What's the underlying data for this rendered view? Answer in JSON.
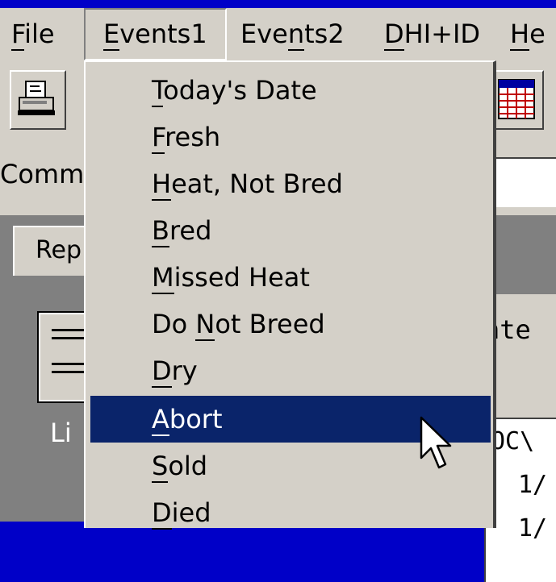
{
  "menubar": {
    "items": [
      {
        "pre": "",
        "hot": "F",
        "post": "ile"
      },
      {
        "pre": "",
        "hot": "E",
        "post": "vents1"
      },
      {
        "pre": "Eve",
        "hot": "n",
        "post": "ts2"
      },
      {
        "pre": "",
        "hot": "D",
        "post": "HI+ID"
      },
      {
        "pre": "",
        "hot": "H",
        "post": "e"
      }
    ]
  },
  "background": {
    "comm_label": "Comm",
    "tab_label": "Rep",
    "list_label": "Li",
    "right_text": "nte",
    "path_text": "OC\\",
    "row1": "1/",
    "row2": "1/"
  },
  "dropdown": {
    "items": [
      {
        "pre": "",
        "hot": "T",
        "post": "oday's Date",
        "selected": false
      },
      {
        "pre": "",
        "hot": "F",
        "post": "resh",
        "selected": false
      },
      {
        "pre": "",
        "hot": "H",
        "post": "eat, Not Bred",
        "selected": false
      },
      {
        "pre": "",
        "hot": "B",
        "post": "red",
        "selected": false
      },
      {
        "pre": "",
        "hot": "M",
        "post": "issed Heat",
        "selected": false
      },
      {
        "pre": "Do ",
        "hot": "N",
        "post": "ot Breed",
        "selected": false
      },
      {
        "pre": "",
        "hot": "D",
        "post": "ry",
        "selected": false
      },
      {
        "pre": "",
        "hot": "A",
        "post": "bort",
        "selected": true
      },
      {
        "pre": "",
        "hot": "S",
        "post": "old",
        "selected": false
      },
      {
        "pre": "",
        "hot": "D",
        "post": "ied",
        "selected": false
      }
    ]
  },
  "colors": {
    "desktop": "#0000c8",
    "face": "#d4d0c8",
    "highlight": "#0a246a"
  },
  "icons": [
    "printer-icon",
    "calendar-icon",
    "list-report-icon",
    "mouse-pointer-icon"
  ]
}
